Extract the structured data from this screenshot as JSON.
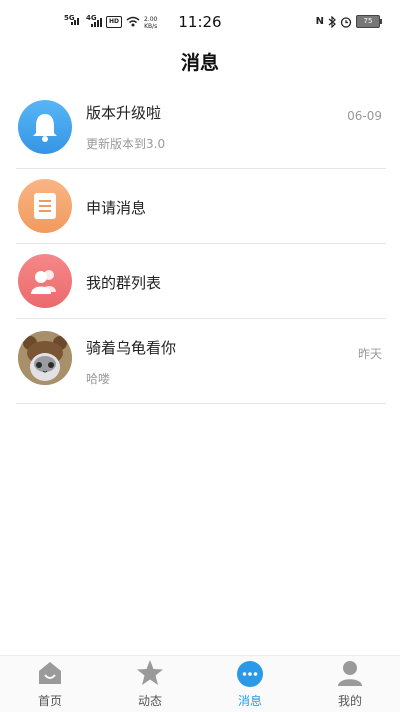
{
  "status_bar": {
    "network1": "5G",
    "network2": "4G",
    "hd": "HD",
    "speed_value": "2.00",
    "speed_unit": "KB/s",
    "time": "11:26",
    "battery": "75"
  },
  "header": {
    "title": "消息"
  },
  "messages": [
    {
      "icon": "bell-icon",
      "name": "版本升级啦",
      "subtitle": "更新版本到3.0",
      "time": "06-09",
      "color": "#4aa8ee"
    },
    {
      "icon": "notice-icon",
      "name": "申请消息",
      "color": "#f5a36c"
    },
    {
      "icon": "group-icon",
      "name": "我的群列表",
      "color": "#f0797a"
    },
    {
      "icon": "user-avatar",
      "name": "骑着乌龟看你",
      "subtitle": "哈喽",
      "time": "昨天"
    }
  ],
  "tabs": [
    {
      "icon": "home-icon",
      "label": "首页",
      "active": false
    },
    {
      "icon": "star-icon",
      "label": "动态",
      "active": false
    },
    {
      "icon": "chat-bubble-icon",
      "label": "消息",
      "active": true
    },
    {
      "icon": "profile-icon",
      "label": "我的",
      "active": false
    }
  ],
  "colors": {
    "accent": "#2a9ae8",
    "divider": "#e6e6e6",
    "muted_text": "#999999"
  }
}
